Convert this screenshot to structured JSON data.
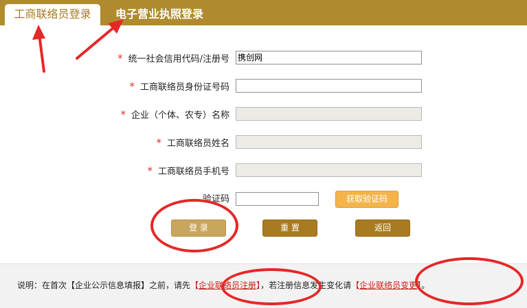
{
  "tabs": {
    "active": "工商联络员登录",
    "inactive": "电子营业执照登录"
  },
  "form": {
    "fields": [
      {
        "label": "统一社会信用代码/注册号",
        "required": true,
        "value": "携创网",
        "disabled": false
      },
      {
        "label": "工商联络员身份证号码",
        "required": true,
        "value": "",
        "disabled": false
      },
      {
        "label": "企业（个体、农专）名称",
        "required": true,
        "value": "",
        "disabled": true
      },
      {
        "label": "工商联络员姓名",
        "required": true,
        "value": "",
        "disabled": true
      },
      {
        "label": "工商联络员手机号",
        "required": true,
        "value": "",
        "disabled": true
      }
    ],
    "captcha": {
      "label": "验证码",
      "value": "",
      "button": "获取验证码"
    },
    "star": "*"
  },
  "buttons": {
    "login": "登 录",
    "reset": "重 置",
    "back": "返回"
  },
  "footer": {
    "prefix": "说明：在首次【企业公示信息填报】之前，请先",
    "open1": "【",
    "link1": "企业联络员注册",
    "close1": "】",
    "middle": "，若注册信息发生变化请",
    "open2": "【",
    "link2": "企业联络员变更",
    "close2": "】",
    "suffix": "。"
  },
  "colors": {
    "brand": "#b08a2e",
    "required": "#d9322e",
    "annotation": "#e52727"
  }
}
